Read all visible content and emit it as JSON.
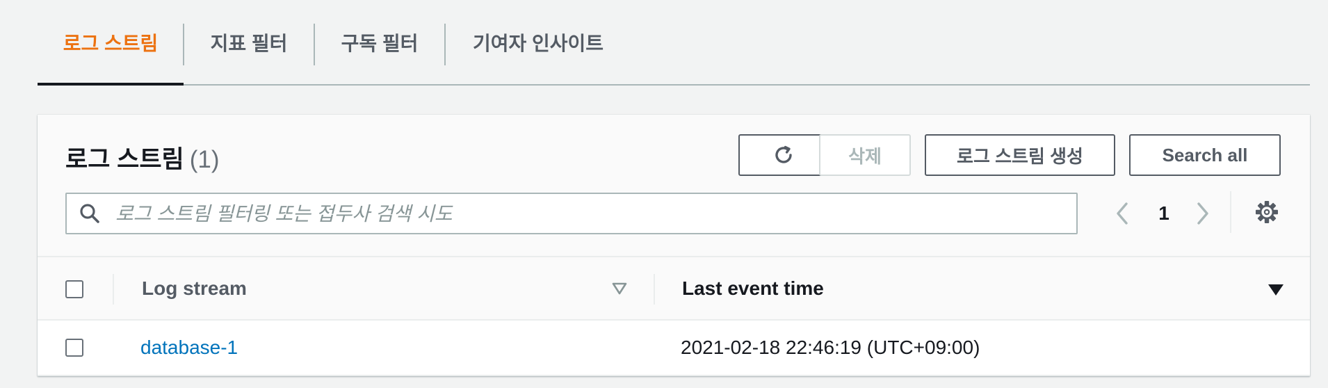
{
  "tabs": [
    {
      "label": "로그 스트림",
      "active": true
    },
    {
      "label": "지표 필터",
      "active": false
    },
    {
      "label": "구독 필터",
      "active": false
    },
    {
      "label": "기여자 인사이트",
      "active": false
    }
  ],
  "panel": {
    "title": "로그 스트림",
    "count": "(1)"
  },
  "buttons": {
    "refresh_icon": "refresh-icon",
    "delete_label": "삭제",
    "create_label": "로그 스트림 생성",
    "search_all_label": "Search all"
  },
  "search": {
    "placeholder": "로그 스트림 필터링 또는 접두사 검색 시도",
    "value": ""
  },
  "pagination": {
    "current_page": "1"
  },
  "table": {
    "columns": [
      {
        "label": "Log stream"
      },
      {
        "label": "Last event time"
      }
    ],
    "rows": [
      {
        "log_stream": "database-1",
        "last_event_time": "2021-02-18 22:46:19 (UTC+09:00)"
      }
    ]
  },
  "colors": {
    "accent": "#ec7211",
    "link": "#0073bb",
    "text": "#16191f",
    "secondary_text": "#545b64"
  }
}
